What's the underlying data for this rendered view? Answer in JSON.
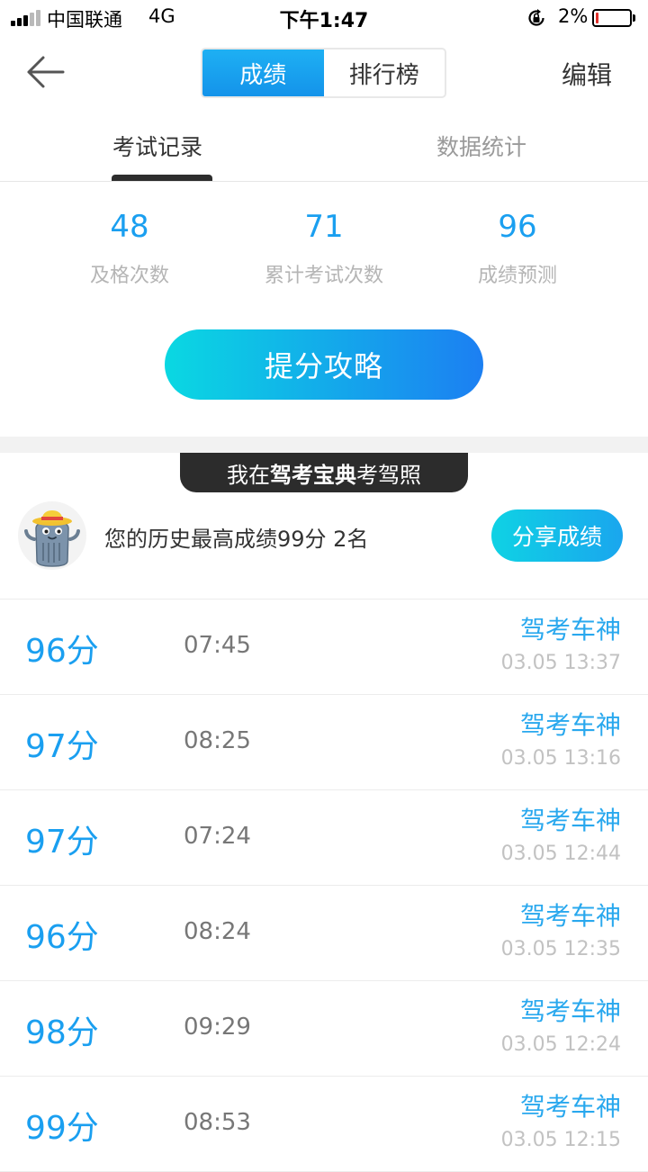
{
  "status_bar": {
    "carrier": "中国联通",
    "network": "4G",
    "time": "下午1:47",
    "battery_percent": "2%",
    "battery_level": 0.02,
    "icons": [
      "signal-icon",
      "rotation-lock-icon",
      "battery-icon"
    ]
  },
  "nav": {
    "back_icon": "back-arrow-icon",
    "segments": [
      "成绩",
      "排行榜"
    ],
    "active_segment": 0,
    "edit_label": "编辑"
  },
  "tabs": {
    "items": [
      "考试记录",
      "数据统计"
    ],
    "active": 0
  },
  "stats": [
    {
      "value": "48",
      "label": "及格次数"
    },
    {
      "value": "71",
      "label": "累计考试次数"
    },
    {
      "value": "96",
      "label": "成绩预测"
    }
  ],
  "boost_button": "提分攻略",
  "banner": {
    "prefix": "我在",
    "bold": "驾考宝典",
    "suffix": "考驾照"
  },
  "best": {
    "text": "您的历史最高成绩99分 2名",
    "share_label": "分享成绩"
  },
  "records": [
    {
      "score": "96分",
      "duration": "07:45",
      "title": "驾考车神",
      "date": "03.05 13:37"
    },
    {
      "score": "97分",
      "duration": "08:25",
      "title": "驾考车神",
      "date": "03.05 13:16"
    },
    {
      "score": "97分",
      "duration": "07:24",
      "title": "驾考车神",
      "date": "03.05 12:44"
    },
    {
      "score": "96分",
      "duration": "08:24",
      "title": "驾考车神",
      "date": "03.05 12:35"
    },
    {
      "score": "98分",
      "duration": "09:29",
      "title": "驾考车神",
      "date": "03.05 12:24"
    },
    {
      "score": "99分",
      "duration": "08:53",
      "title": "驾考车神",
      "date": "03.05 12:15"
    }
  ],
  "colors": {
    "accent": "#1a9ff0",
    "gradient_start": "#0ad8e2",
    "gradient_end": "#1c7ff2",
    "banner_bg": "#2c2c2c",
    "battery_low": "#e0302a"
  }
}
